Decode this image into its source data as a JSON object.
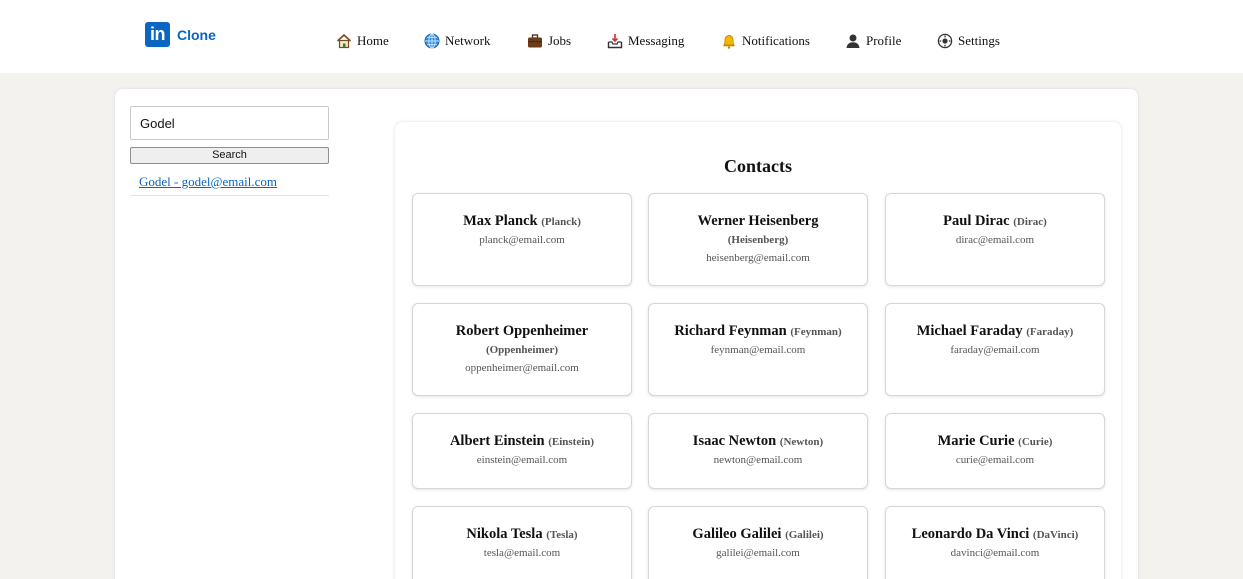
{
  "brand": {
    "logo_mark": "in",
    "name": "Clone",
    "color": "#0a66c2"
  },
  "nav": [
    {
      "label": "Home",
      "icon": "home-icon"
    },
    {
      "label": "Network",
      "icon": "globe-icon"
    },
    {
      "label": "Jobs",
      "icon": "briefcase-icon"
    },
    {
      "label": "Messaging",
      "icon": "inbox-tray-icon"
    },
    {
      "label": "Notifications",
      "icon": "bell-icon"
    },
    {
      "label": "Profile",
      "icon": "user-silhouette-icon"
    },
    {
      "label": "Settings",
      "icon": "gear-icon"
    }
  ],
  "search": {
    "value": "Godel",
    "button_label": "Search"
  },
  "results": [
    {
      "text": "Godel - godel@email.com"
    }
  ],
  "contacts": {
    "title": "Contacts",
    "items": [
      {
        "name": "Max Planck",
        "nick": "(Planck)",
        "email": "planck@email.com"
      },
      {
        "name": "Werner Heisenberg",
        "nick": "(Heisenberg)",
        "email": "heisenberg@email.com"
      },
      {
        "name": "Paul Dirac",
        "nick": "(Dirac)",
        "email": "dirac@email.com"
      },
      {
        "name": "Robert Oppenheimer",
        "nick": "(Oppenheimer)",
        "email": "oppenheimer@email.com"
      },
      {
        "name": "Richard Feynman",
        "nick": "(Feynman)",
        "email": "feynman@email.com"
      },
      {
        "name": "Michael Faraday",
        "nick": "(Faraday)",
        "email": "faraday@email.com"
      },
      {
        "name": "Albert Einstein",
        "nick": "(Einstein)",
        "email": "einstein@email.com"
      },
      {
        "name": "Isaac Newton",
        "nick": "(Newton)",
        "email": "newton@email.com"
      },
      {
        "name": "Marie Curie",
        "nick": "(Curie)",
        "email": "curie@email.com"
      },
      {
        "name": "Nikola Tesla",
        "nick": "(Tesla)",
        "email": "tesla@email.com"
      },
      {
        "name": "Galileo Galilei",
        "nick": "(Galilei)",
        "email": "galilei@email.com"
      },
      {
        "name": "Leonardo Da Vinci",
        "nick": "(DaVinci)",
        "email": "davinci@email.com"
      }
    ]
  }
}
